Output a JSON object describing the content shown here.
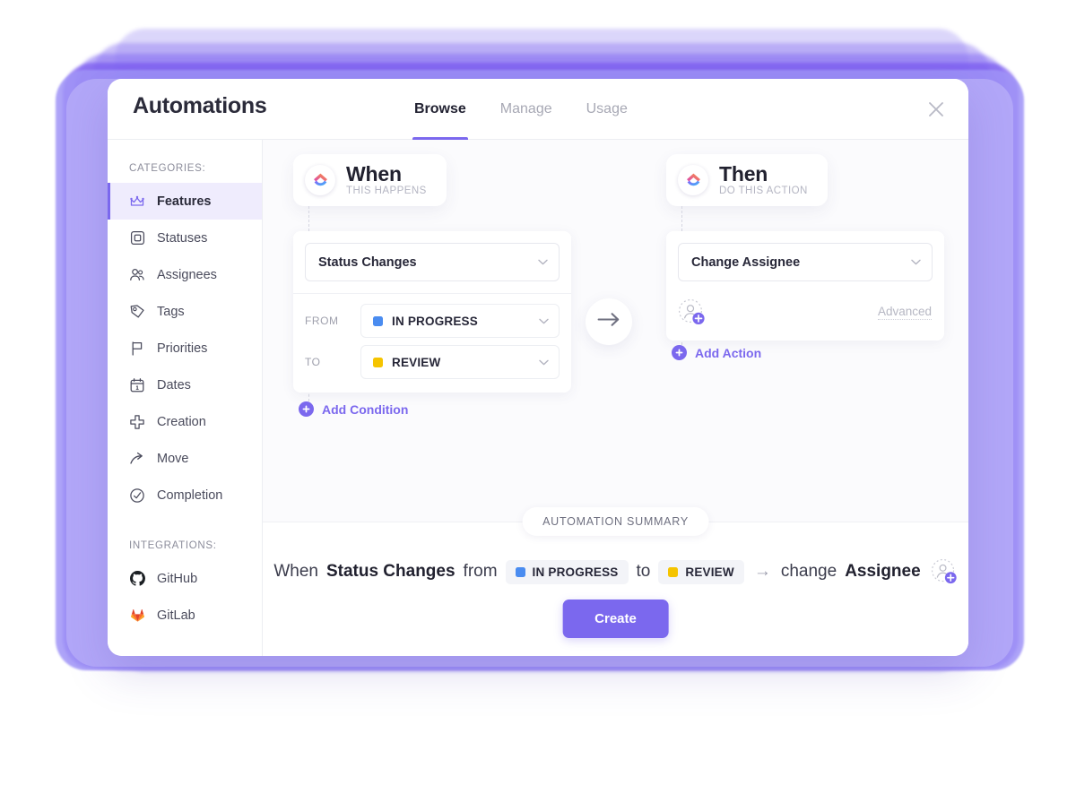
{
  "window": {
    "title": "Automations",
    "close_icon": "close-icon"
  },
  "tabs": [
    {
      "label": "Browse",
      "active": true
    },
    {
      "label": "Manage",
      "active": false
    },
    {
      "label": "Usage",
      "active": false
    }
  ],
  "sidebar": {
    "categories_label": "CATEGORIES:",
    "integrations_label": "INTEGRATIONS:",
    "categories": [
      {
        "label": "Features",
        "icon": "crown-icon",
        "active": true
      },
      {
        "label": "Statuses",
        "icon": "square-outline-icon",
        "active": false
      },
      {
        "label": "Assignees",
        "icon": "people-icon",
        "active": false
      },
      {
        "label": "Tags",
        "icon": "tag-icon",
        "active": false
      },
      {
        "label": "Priorities",
        "icon": "flag-icon",
        "active": false
      },
      {
        "label": "Dates",
        "icon": "calendar-icon",
        "active": false
      },
      {
        "label": "Creation",
        "icon": "plus-cross-icon",
        "active": false
      },
      {
        "label": "Move",
        "icon": "arrow-curve-icon",
        "active": false
      },
      {
        "label": "Completion",
        "icon": "check-circle-icon",
        "active": false
      }
    ],
    "integrations": [
      {
        "label": "GitHub",
        "icon": "github-icon"
      },
      {
        "label": "GitLab",
        "icon": "gitlab-icon"
      }
    ]
  },
  "trigger": {
    "badge_title": "When",
    "badge_subtitle": "THIS HAPPENS",
    "logo_icon": "clickup-logo-icon",
    "trigger_value": "Status Changes",
    "from_label": "FROM",
    "from_value": "IN PROGRESS",
    "from_color": "#4a8cf0",
    "to_label": "TO",
    "to_value": "REVIEW",
    "to_color": "#f5c400",
    "add_condition_label": "Add Condition"
  },
  "action": {
    "badge_title": "Then",
    "badge_subtitle": "DO THIS ACTION",
    "logo_icon": "clickup-logo-icon",
    "action_value": "Change Assignee",
    "advanced_label": "Advanced",
    "add_action_label": "Add Action",
    "assignee_placeholder_icon": "add-assignee-icon"
  },
  "connector": {
    "arrow_icon": "arrow-right-icon"
  },
  "summary": {
    "chip_label": "AUTOMATION SUMMARY",
    "word_when": "When",
    "trigger_bold": "Status Changes",
    "word_from": "from",
    "from_badge": "IN PROGRESS",
    "from_color": "#4a8cf0",
    "word_to": "to",
    "to_badge": "REVIEW",
    "to_color": "#f5c400",
    "arrow": "→",
    "word_change": "change",
    "action_bold": "Assignee",
    "create_label": "Create"
  },
  "colors": {
    "accent": "#7b68ee",
    "active_nav_bg": "#efecfd",
    "canvas_bg": "#fbfbfd",
    "badge_bg": "#f3f4f8"
  }
}
